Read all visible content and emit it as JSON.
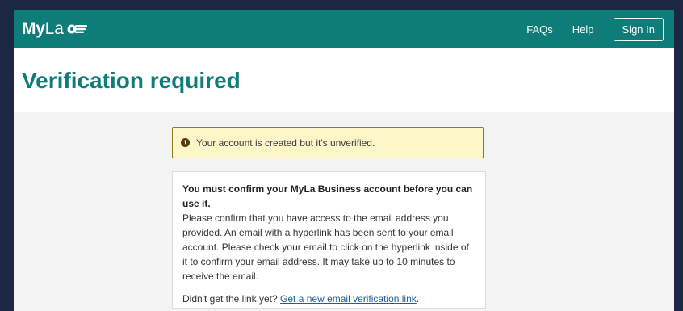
{
  "header": {
    "logo_my": "My",
    "logo_la": "La",
    "nav": {
      "faqs": "FAQs",
      "help": "Help"
    },
    "sign_in": "Sign In",
    "brand_color": "#0e7c78"
  },
  "page": {
    "title": "Verification required"
  },
  "alert": {
    "icon": "exclamation-icon",
    "text": "Your account is created but it's unverified."
  },
  "card": {
    "lead": "You must confirm your MyLa Business account before you can use it.",
    "body": "Please confirm that you have access to the email address you provided. An email with a hyperlink has been sent to your email account. Please check your email to click on the hyperlink inside of it to confirm your email address. It may take up to 10 minutes to receive the email.",
    "footer_prefix": "Didn't get the link yet? ",
    "footer_link": "Get a new email verification link",
    "footer_suffix": "."
  }
}
